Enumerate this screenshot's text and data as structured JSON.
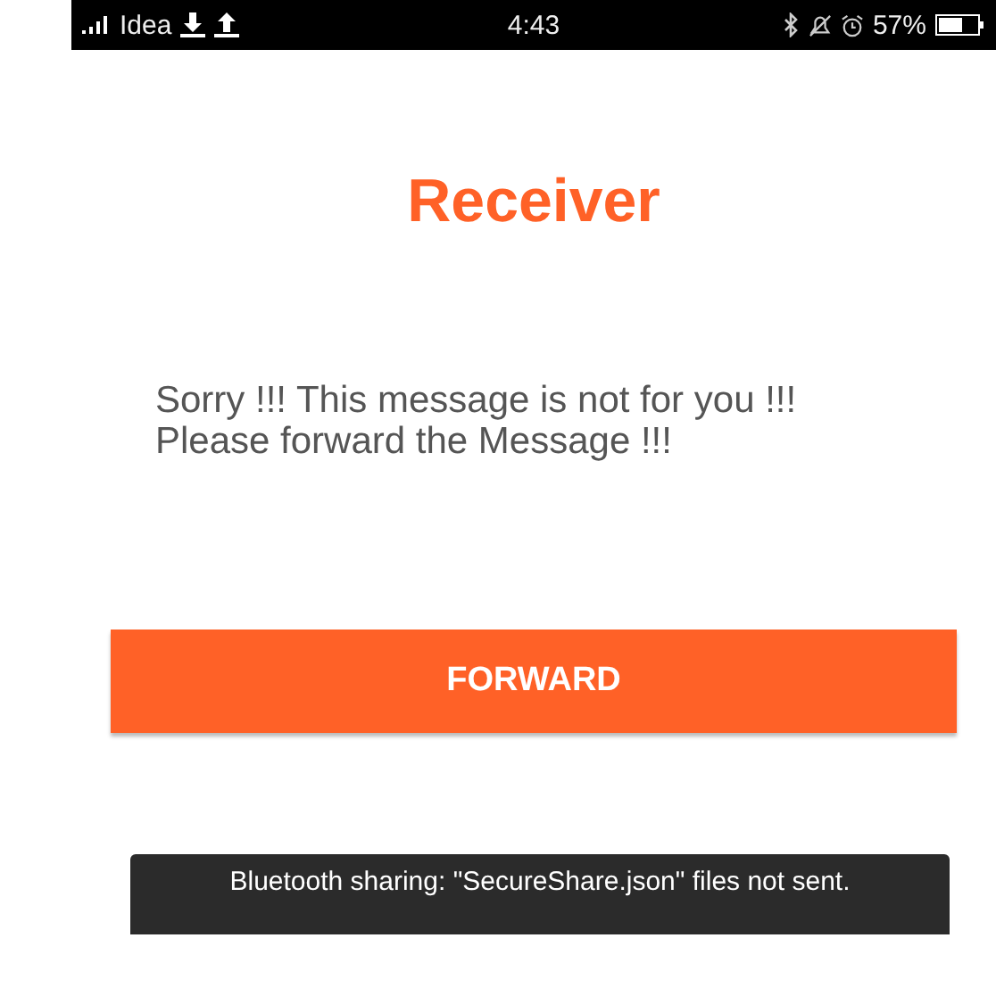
{
  "status_bar": {
    "carrier": "Idea",
    "time": "4:43",
    "battery": "57%"
  },
  "title": "Receiver",
  "message": [
    "Sorry !!! This message is not for you !!!",
    "Please forward the Message !!!"
  ],
  "button": "FORWARD",
  "toast": "Bluetooth sharing: \"SecureShare.json\" files not sent."
}
